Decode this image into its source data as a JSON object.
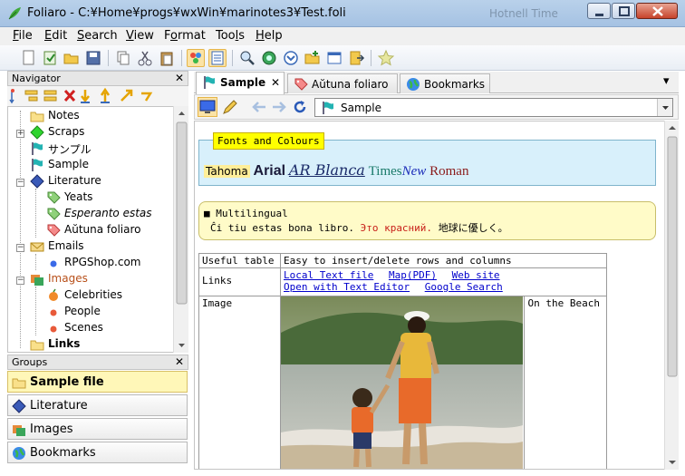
{
  "window": {
    "title": "Foliaro - C:¥Home¥progs¥wxWin¥marinotes3¥Test.foli",
    "background_title": "Hotnell Time",
    "colors": {
      "titlebar": "#b9d1ea",
      "selected_group": "#fff7b8"
    }
  },
  "menu": [
    "File",
    "Edit",
    "Search",
    "View",
    "Format",
    "Tools",
    "Help"
  ],
  "menu_mnemonics": [
    "F",
    "E",
    "S",
    "V",
    "o",
    "l",
    "H"
  ],
  "navigator": {
    "header": "Navigator",
    "close": "✕",
    "tree": [
      {
        "label": "Notes",
        "icon": "folder-icon"
      },
      {
        "label": "Scraps",
        "icon": "green-diamond-icon"
      },
      {
        "label": "サンプル",
        "icon": "flag-icon"
      },
      {
        "label": "Sample",
        "icon": "flag-icon",
        "selected": true
      },
      {
        "label": "Literature",
        "icon": "blue-diamond-icon"
      },
      {
        "label": "Yeats",
        "icon": "tag-icon"
      },
      {
        "label": "Esperanto estas",
        "icon": "tag-icon"
      },
      {
        "label": "Aŭtuna foliaro",
        "icon": "tag-red-icon"
      },
      {
        "label": "Emails",
        "icon": "envelope-icon"
      },
      {
        "label": "RPGShop.com",
        "icon": "blue-dot-icon"
      },
      {
        "label": "Images",
        "icon": "images-icon"
      },
      {
        "label": "Celebrities",
        "icon": "red-dot-icon"
      },
      {
        "label": "People",
        "icon": "red-dot-icon"
      },
      {
        "label": "Scenes",
        "icon": "red-dot-icon"
      },
      {
        "label": "Links",
        "icon": "folder-icon"
      }
    ]
  },
  "groups": {
    "header": "Groups",
    "close": "✕",
    "items": [
      {
        "label": "Sample file",
        "icon": "folder-icon",
        "selected": true
      },
      {
        "label": "Literature",
        "icon": "blue-diamond-icon"
      },
      {
        "label": "Images",
        "icon": "images-icon"
      },
      {
        "label": "Bookmarks",
        "icon": "globe-icon"
      }
    ]
  },
  "tabs": [
    {
      "label": "Sample",
      "icon": "flag-icon",
      "active": true,
      "close": "✕"
    },
    {
      "label": "Aŭtuna foliaro",
      "icon": "tag-red-icon"
    },
    {
      "label": "Bookmarks",
      "icon": "globe-icon"
    }
  ],
  "tab_menu": "▾",
  "address": {
    "value": "Sample"
  },
  "document": {
    "fonts_title": "Fonts and Colours",
    "fonts_samples": [
      "Tahoma",
      "Arial",
      "AR Blanca",
      "Times",
      "New",
      "Roman"
    ],
    "multilingual_title": "■ Multilingual",
    "multilingual_eo": "Ĉi tiu estas bona libro.",
    "multilingual_ru": "Это красний.",
    "multilingual_ja": "地球に優しく。",
    "table": {
      "row1": {
        "label": "Useful table",
        "value": "Easy to insert/delete rows and columns"
      },
      "row2": {
        "label": "Links",
        "links": [
          "Local Text file",
          "Map(PDF)",
          "Web site",
          "Open with Text Editor",
          "Google Search"
        ]
      },
      "row3": {
        "label": "Image",
        "caption": "On the Beach"
      }
    }
  }
}
